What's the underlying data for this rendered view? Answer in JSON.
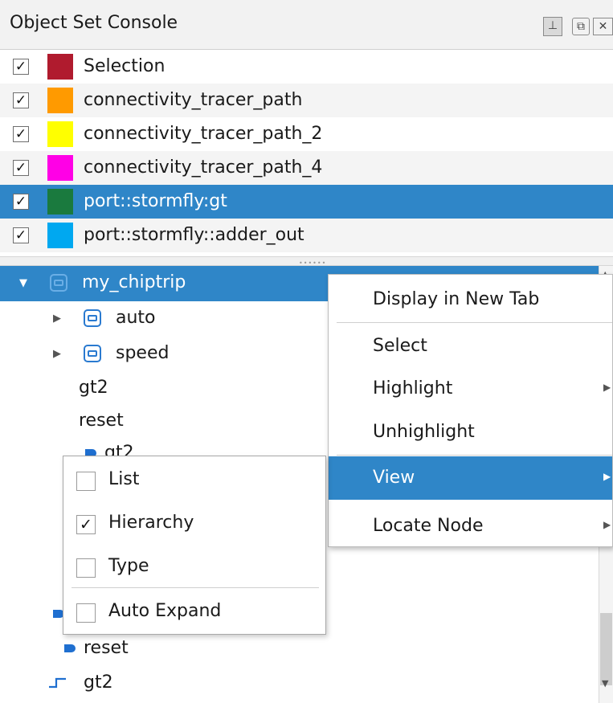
{
  "panel": {
    "title": "Object Set Console",
    "buttons": {
      "pin": "⊥",
      "float": "⧉",
      "close": "✕"
    }
  },
  "object_sets": [
    {
      "label": "Selection",
      "checked": true,
      "color": "#b01b2e"
    },
    {
      "label": "connectivity_tracer_path",
      "checked": true,
      "color": "#ff9a00"
    },
    {
      "label": "connectivity_tracer_path_2",
      "checked": true,
      "color": "#ffff00"
    },
    {
      "label": "connectivity_tracer_path_4",
      "checked": true,
      "color": "#ff00e6"
    },
    {
      "label": "port::stormfly:gt",
      "checked": true,
      "color": "#1a7a3e",
      "selected": true
    },
    {
      "label": "port::stormfly::adder_out",
      "checked": true,
      "color": "#00a8f0"
    }
  ],
  "check_mark": "✓",
  "tree": {
    "root": "my_chiptrip",
    "nodes": [
      {
        "label": "auto",
        "icon": "instance-icon",
        "expandable": true
      },
      {
        "label": "speed",
        "icon": "instance-icon",
        "expandable": true
      },
      {
        "label": "gt2",
        "icon": "none"
      },
      {
        "label": "reset",
        "icon": "none"
      },
      {
        "label": "gt2",
        "icon": "port-icon"
      },
      {
        "label": "reset",
        "icon": "port-icon"
      },
      {
        "label": "gt2",
        "icon": "signal-icon"
      }
    ]
  },
  "context_menu": {
    "items": [
      {
        "label": "Display in New Tab",
        "has_submenu": false
      },
      {
        "label": "Select",
        "has_submenu": false
      },
      {
        "label": "Highlight",
        "has_submenu": true
      },
      {
        "label": "Unhighlight",
        "has_submenu": false
      },
      {
        "label": "View",
        "has_submenu": true,
        "active": true
      },
      {
        "label": "Locate Node",
        "has_submenu": true
      }
    ]
  },
  "view_submenu": {
    "items": [
      {
        "label": "List",
        "checked": false
      },
      {
        "label": "Hierarchy",
        "checked": true
      },
      {
        "label": "Type",
        "checked": false
      },
      {
        "label": "Auto Expand",
        "checked": false
      }
    ]
  },
  "colors": {
    "selection_blue": "#2f86c8",
    "icon_blue": "#2a7ad0"
  }
}
